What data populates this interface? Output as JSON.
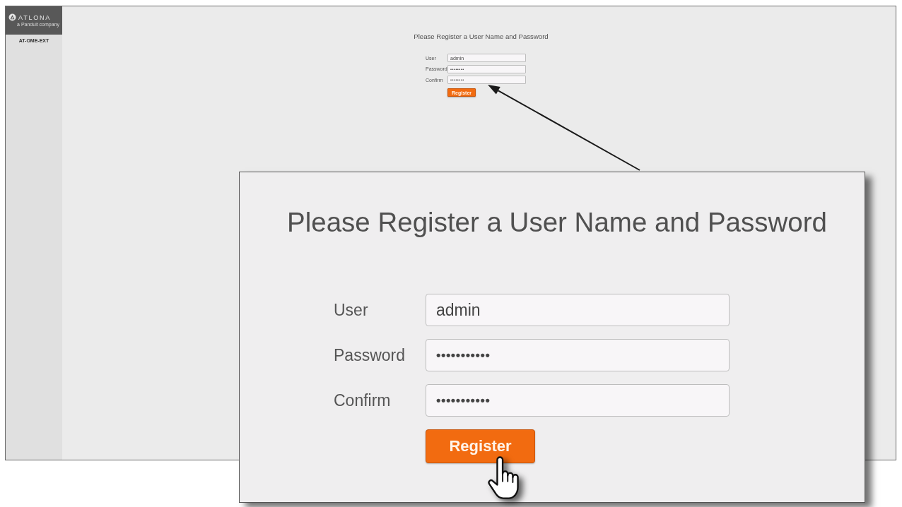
{
  "screenshot": {
    "logo": {
      "name": "ATLONA",
      "tagline": "a Panduit company"
    },
    "sidebar": {
      "device_name": "AT-OME-EXT"
    },
    "form": {
      "title": "Please Register a User Name and Password",
      "fields": [
        {
          "label": "User",
          "value": "admin",
          "kind": "text"
        },
        {
          "label": "Password",
          "value": "••••••••",
          "kind": "password"
        },
        {
          "label": "Confirm",
          "value": "••••••••",
          "kind": "password"
        }
      ],
      "button": "Register"
    }
  },
  "callout": {
    "form": {
      "title": "Please Register a User Name and Password",
      "fields": [
        {
          "label": "User",
          "value": "admin",
          "kind": "text"
        },
        {
          "label": "Password",
          "value": "•••••••••••",
          "kind": "password"
        },
        {
          "label": "Confirm",
          "value": "•••••••••••",
          "kind": "password"
        }
      ],
      "button": "Register"
    }
  }
}
